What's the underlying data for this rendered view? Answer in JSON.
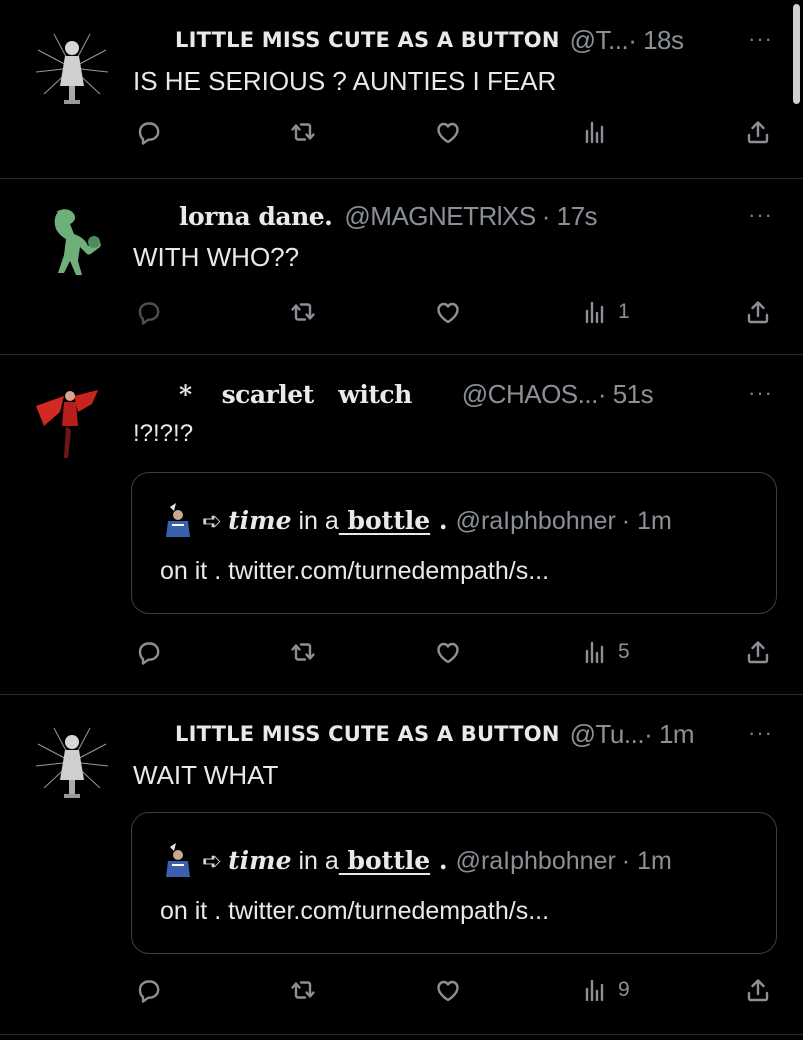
{
  "tweets": [
    {
      "name": "LITTLE MISS CUTE AS A BUTTON",
      "handle": "@T...",
      "time": "· 18s",
      "more": "···",
      "text": "IS HE SERIOUS ? AUNTIES I FEAR",
      "views": ""
    },
    {
      "name": "lorna dane.",
      "handle": "@MAGNETRlXS",
      "time": "· 17s",
      "more": "···",
      "text": "WITH  WHO??",
      "views": "1"
    },
    {
      "name_prefix": "*",
      "name": "scarlet   witch",
      "handle": "@CHAOS...",
      "time": "· 51s",
      "more": "···",
      "text": "!?!?!?",
      "views": "5",
      "quote": {
        "arrow": "➪",
        "name_time": "time",
        "name_in": " in a",
        "name_bottle": " bottle",
        "name_dot": " .",
        "handle": "@raIphbohner",
        "time": "· 1m",
        "text": "on it . twitter.com/turnedempath/s..."
      }
    },
    {
      "name": "LITTLE MISS CUTE AS A BUTTON",
      "handle": "@Tu...",
      "time": "· 1m",
      "more": "···",
      "text": "WAIT WHAT",
      "views": "9",
      "quote": {
        "arrow": "➪",
        "name_time": "time",
        "name_in": " in a",
        "name_bottle": " bottle",
        "name_dot": " .",
        "handle": "@raIphbohner",
        "time": "· 1m",
        "text": "on it . twitter.com/turnedempath/s..."
      }
    }
  ],
  "icons": [
    "reply-icon",
    "retweet-icon",
    "like-icon",
    "views-icon",
    "share-icon"
  ],
  "colors": {
    "background": "#000000",
    "text": "#e7e9ea",
    "muted": "#8b9096",
    "border": "#2a2d30"
  }
}
